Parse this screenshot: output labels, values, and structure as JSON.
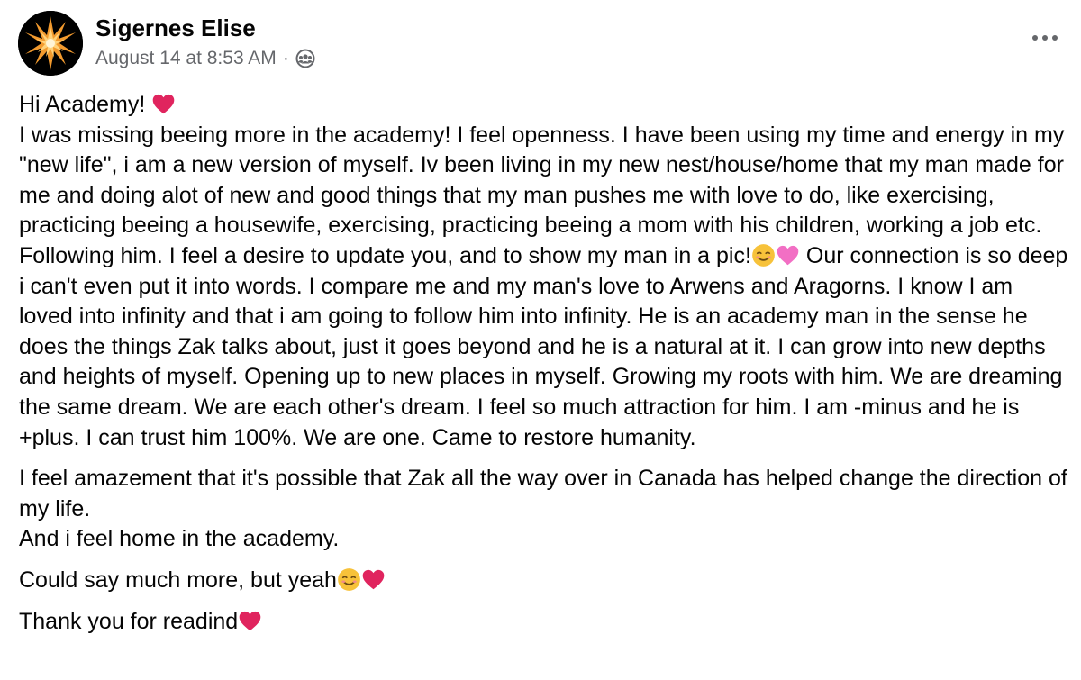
{
  "post": {
    "author": "Sigernes Elise",
    "timestamp": "August 14 at 8:53 AM",
    "separator": "·",
    "audience_icon": "group-icon",
    "more_icon": "more-horizontal-icon",
    "paragraph1": {
      "greeting": "Hi Academy! ",
      "text_a": "I was missing beeing more in the academy! I feel openness. I have been using my time and energy in my \"new life\", i am a new version of myself. Iv been living in my new nest/house/home that my man made for me and doing alot of new and good things that my man pushes me with love to do, like exercising, practicing beeing a housewife, exercising, practicing beeing a mom with his children, working a job etc. Following him. I feel a desire to update you, and to show my man in a pic!",
      "text_b": " Our connection is so deep i can't even put it into words. I compare me and my man's love to Arwens and Aragorns. I know I am loved into infinity and that i am going to follow him into infinity. He is an academy man in the sense he does the things Zak talks about, just it goes beyond and he is a natural at it. I can grow into new depths and heights of myself. Opening up to new places in myself. Growing my roots with him. We are dreaming the same dream. We are each other's dream. I feel so much attraction for him. I am -minus and he is +plus. I can trust him 100%. We are one. Came to restore humanity."
    },
    "paragraph2": {
      "line1": "I feel amazement that it's possible that Zak all the way over in Canada has helped change the direction of my life.",
      "line2": "And i feel home in the academy."
    },
    "paragraph3": "Could say much more, but yeah",
    "paragraph4": "Thank you for readind"
  },
  "colors": {
    "text": "#050505",
    "secondary": "#65676b",
    "heart": "#e0245e",
    "pink_heart": "#f26fc4",
    "smile": "#f7c23a"
  }
}
